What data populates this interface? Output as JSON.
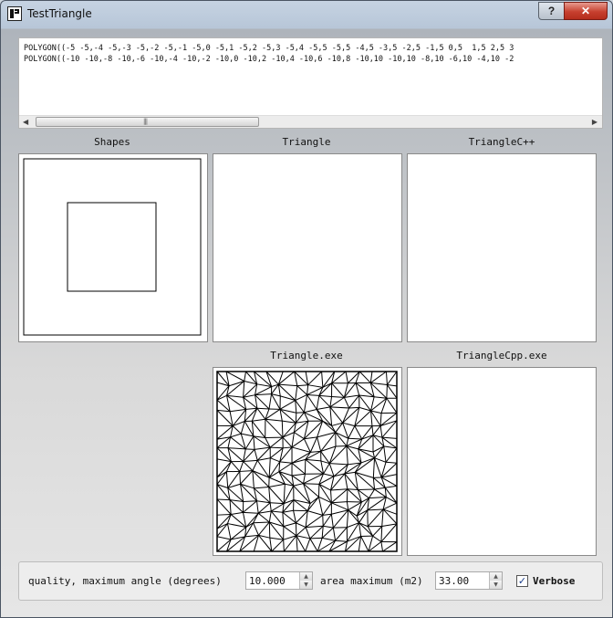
{
  "window": {
    "title": "TestTriangle",
    "help_label": "?",
    "close_label": "✕",
    "icon": "app-logo-icon"
  },
  "wkt": {
    "line1": "POLYGON((-5 -5,-4 -5,-3 -5,-2 -5,-1 -5,0 -5,1 -5,2 -5,3 -5,4 -5,5 -5,5 -4,5 -3,5 -2,5 -1,5 0,5  1,5 2,5 3",
    "line2": "POLYGON((-10 -10,-8 -10,-6 -10,-4 -10,-2 -10,0 -10,2 -10,4 -10,6 -10,8 -10,10 -10,10 -8,10 -6,10 -4,10 -2"
  },
  "panels": {
    "shapes": "Shapes",
    "triangle": "Triangle",
    "trianglecpp": "TriangleC++",
    "triangle_exe": "Triangle.exe",
    "trianglecpp_exe": "TriangleCpp.exe"
  },
  "controls": {
    "quality_label": "quality, maximum angle (degrees)",
    "quality_value": "10.000",
    "area_label": "area maximum (m2)",
    "area_value": "33.00",
    "verbose_label": "Verbose",
    "verbose_checked": true
  }
}
